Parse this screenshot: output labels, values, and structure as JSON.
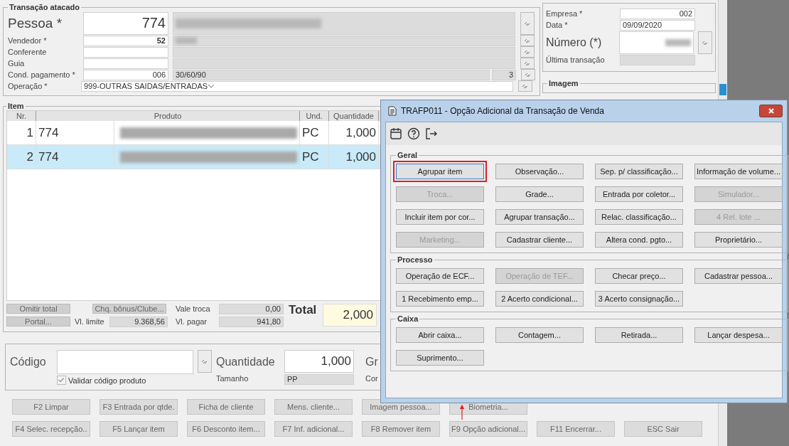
{
  "header_group": {
    "title": "Transação atacado",
    "pessoa": {
      "label": "Pessoa *",
      "value": "774",
      "name_blurred": true
    },
    "rows": [
      {
        "kind": "lookup",
        "label": "Vendedor *",
        "value": "52",
        "name_blurred": true
      },
      {
        "kind": "lookup",
        "label": "Conferente",
        "name_blurred": false
      },
      {
        "kind": "lookup",
        "label": "Guia",
        "name_blurred": false
      },
      {
        "kind": "installments",
        "label": "Cond. pagamento *",
        "value": "006",
        "description": "30/60/90",
        "count": "3"
      },
      {
        "kind": "select",
        "label": "Operação *",
        "value": "999-OUTRAS SAIDAS/ENTRADAS"
      }
    ]
  },
  "company_group": {
    "empresa": {
      "label": "Empresa *",
      "value": "002"
    },
    "data": {
      "label": "Data *",
      "value": "09/09/2020"
    },
    "numero": {
      "label": "Número (*)",
      "value_blurred": true
    },
    "ultima": {
      "label": "Última transação"
    }
  },
  "image_group": {
    "title": "Imagem"
  },
  "item_group": {
    "title": "Item",
    "columns": [
      "Nr.",
      "Produto",
      "Und.",
      "Quantidade"
    ],
    "rows": [
      {
        "nr": "1",
        "code": "774",
        "unit": "PC",
        "quantity": "1,000",
        "selected": false
      },
      {
        "nr": "2",
        "code": "774",
        "unit": "PC",
        "quantity": "1,000",
        "selected": true
      }
    ],
    "buttons": [
      "Omitir total",
      "Portal...",
      "Chq. bônus/Clube..."
    ],
    "vale_troca": {
      "label": "Vale troca",
      "value": "0,00"
    },
    "vl_limite": {
      "label": "Vl. limite",
      "value": "9.368,56"
    },
    "vl_pagar": {
      "label": "Vl. pagar",
      "value": "941,80"
    },
    "total": {
      "label": "Total",
      "value": "2,000"
    }
  },
  "code_group": {
    "codigo": {
      "label": "Código"
    },
    "validar": {
      "label": "Validar código produto",
      "checked": true
    },
    "quantidade": {
      "label": "Quantidade",
      "value": "1,000"
    },
    "tamanho": {
      "label": "Tamanho",
      "value": "PP"
    },
    "column_3": {
      "label": "Gr"
    },
    "column_4": {
      "label": "Cor"
    }
  },
  "footer_rows": [
    [
      "F2 Limpar",
      "F3 Entrada por qtde.",
      "Ficha de cliente",
      "Mens. cliente...",
      "Imagem pessoa...",
      "Biometria..."
    ],
    [
      "F4 Selec. recepção..",
      "F5 Lançar item",
      "F6 Desconto item...",
      "F7 Inf. adicional...",
      "F8 Remover item",
      "F9 Opção adicional...",
      "F11 Encerrar...",
      "ESC Sair"
    ]
  ],
  "dialog": {
    "title": "TRAFP011 - Opção Adicional da Transação de Venda",
    "sections": [
      {
        "title": "Geral",
        "buttons": [
          {
            "label": "Agrupar item",
            "disabled": false,
            "highlighted": true
          },
          {
            "label": "Observação...",
            "disabled": false,
            "highlighted": false
          },
          {
            "label": "Sep. p/ classificação...",
            "disabled": false,
            "highlighted": false
          },
          {
            "label": "Informação de volume...",
            "disabled": false,
            "highlighted": false
          },
          {
            "label": "Troca...",
            "disabled": true,
            "highlighted": false
          },
          {
            "label": "Grade...",
            "disabled": false,
            "highlighted": false
          },
          {
            "label": "Entrada por coletor...",
            "disabled": false,
            "highlighted": false
          },
          {
            "label": "Simulador...",
            "disabled": true,
            "highlighted": false
          },
          {
            "label": "Incluir item por cor...",
            "disabled": false,
            "highlighted": false
          },
          {
            "label": "Agrupar transação...",
            "disabled": false,
            "highlighted": false
          },
          {
            "label": "Relac. classificação...",
            "disabled": false,
            "highlighted": false
          },
          {
            "label": "4 Rel. lote ...",
            "disabled": true,
            "highlighted": false
          },
          {
            "label": "Marketing...",
            "disabled": true,
            "highlighted": false
          },
          {
            "label": "Cadastrar cliente...",
            "disabled": false,
            "highlighted": false
          },
          {
            "label": "Altera cond. pgto...",
            "disabled": false,
            "highlighted": false
          },
          {
            "label": "Proprietário...",
            "disabled": false,
            "highlighted": false
          }
        ]
      },
      {
        "title": "Processo",
        "buttons": [
          {
            "label": "Operação de ECF...",
            "disabled": false,
            "highlighted": false
          },
          {
            "label": "Operação de TEF...",
            "disabled": true,
            "highlighted": false
          },
          {
            "label": "Checar preço...",
            "disabled": false,
            "highlighted": false
          },
          {
            "label": "Cadastrar pessoa...",
            "disabled": false,
            "highlighted": false
          },
          {
            "label": "1 Recebimento emp...",
            "disabled": false,
            "highlighted": false
          },
          {
            "label": "2 Acerto condicional...",
            "disabled": false,
            "highlighted": false
          },
          {
            "label": "3 Acerto consignação...",
            "disabled": false,
            "highlighted": false
          }
        ]
      },
      {
        "title": "Caixa",
        "buttons": [
          {
            "label": "Abrir caixa...",
            "disabled": false,
            "highlighted": false
          },
          {
            "label": "Contagem...",
            "disabled": false,
            "highlighted": false
          },
          {
            "label": "Retirada...",
            "disabled": false,
            "highlighted": false
          },
          {
            "label": "Lançar despesa...",
            "disabled": false,
            "highlighted": false
          },
          {
            "label": "Suprimento...",
            "disabled": false,
            "highlighted": false
          }
        ]
      }
    ]
  },
  "annotation_arrow": true
}
